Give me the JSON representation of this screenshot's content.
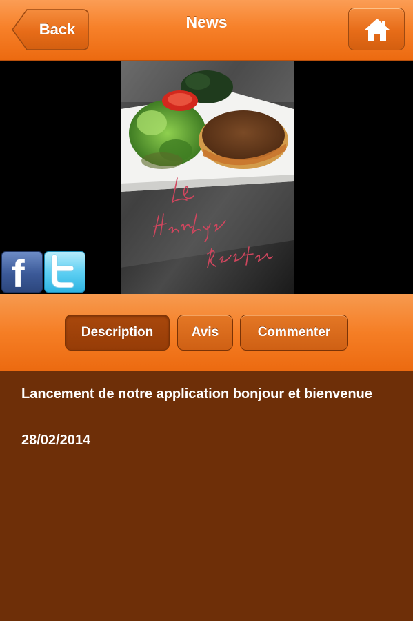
{
  "header": {
    "back_label": "Back",
    "title": "News",
    "home_icon": "home-icon"
  },
  "photo": {
    "description": "food-photo",
    "handwriting": "Le Hamburger Beeton"
  },
  "social": {
    "facebook_glyph": "f",
    "twitter_icon": "twitter-bird-icon"
  },
  "tabs": [
    {
      "label": "Description",
      "active": true
    },
    {
      "label": "Avis",
      "active": false
    },
    {
      "label": "Commenter",
      "active": false
    }
  ],
  "content": {
    "title": "Lancement de notre application bonjour et bienvenue",
    "date": "28/02/2014"
  },
  "colors": {
    "header_orange": "#f7812a",
    "content_brown": "#6e2f08",
    "active_tab": "#963c07"
  }
}
